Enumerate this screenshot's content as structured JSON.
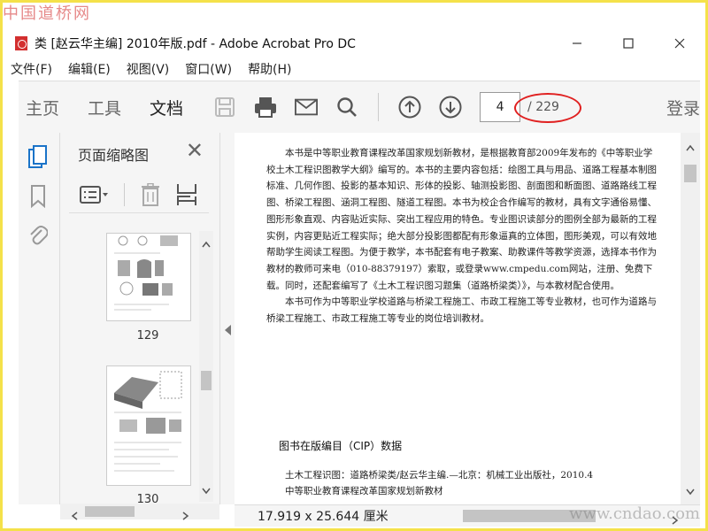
{
  "watermarks": {
    "top": "中国道桥网",
    "bottom": "www.cndao.com"
  },
  "window": {
    "title": "类 [赵云华主编] 2010年版.pdf - Adobe Acrobat Pro DC"
  },
  "menubar": {
    "items": [
      "文件(F)",
      "编辑(E)",
      "视图(V)",
      "窗口(W)",
      "帮助(H)"
    ]
  },
  "toolbar": {
    "tabs": [
      "主页",
      "工具",
      "文档"
    ],
    "active_tab": "文档",
    "current_page": "4",
    "total_pages": "/ 229",
    "login": "登录",
    "icons": [
      "save-icon",
      "print-icon",
      "email-icon",
      "search-icon",
      "prev-page-icon",
      "next-page-icon"
    ]
  },
  "left_rail": {
    "icons": [
      "pages-icon",
      "bookmark-icon",
      "attachment-icon"
    ]
  },
  "panel": {
    "title": "页面缩略图",
    "thumbnails": [
      {
        "label": "129"
      },
      {
        "label": "130"
      }
    ]
  },
  "document": {
    "paragraphs": [
      "本书是中等职业教育课程改革国家规划新教材，是根据教育部2009年发布的《中等职业学校土木工程识图教学大纲》编写的。本书的主要内容包括：绘图工具与用品、道路工程基本制图标准、几何作图、投影的基本知识、形体的投影、轴测投影图、剖面图和断面图、道路路线工程图、桥梁工程图、涵洞工程图、隧道工程图。本书为校企合作编写的教材，具有文字通俗易懂、图形形象直观、内容贴近实际、突出工程应用的特色。专业图识读部分的图例全部为最新的工程实例，内容更贴近工程实际；绝大部分投影图都配有形象逼真的立体图，图形美观，可以有效地帮助学生阅读工程图。为便于教学，本书配套有电子教案、助教课件等教学资源，选择本书作为教材的教师可来电（010-88379197）索取，或登录www.cmpedu.com网站，注册、免费下载。同时，还配套编写了《土木工程识图习题集（道路桥梁类）》，与本教材配合使用。",
      "本书可作为中等职业学校道路与桥梁工程施工、市政工程施工等专业教材，也可作为道路与桥梁工程施工、市政工程施工等专业的岗位培训教材。"
    ],
    "cip_heading": "图书在版编目（CIP）数据",
    "cip_lines": [
      "土木工程识图：道路桥梁类/赵云华主编.—北京：机械工业出版社，2010.4",
      "中等职业教育课程改革国家规划新教材"
    ]
  },
  "status": {
    "dimensions": "17.919 x 25.644 厘米"
  },
  "colors": {
    "frame": "#f4e14a",
    "annotation": "#e02020",
    "accent": "#1a73c8"
  }
}
